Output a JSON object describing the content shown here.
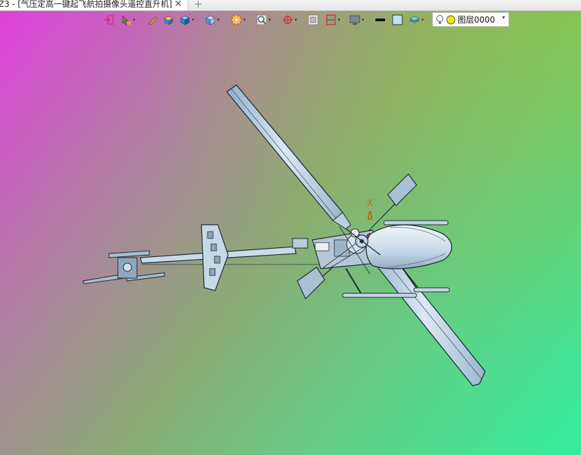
{
  "tab": {
    "title": "Z3 - [气压定高一键起飞航拍摄像头遥控直升机]",
    "close_glyph": "✕",
    "new_tab_glyph": "+"
  },
  "toolbar": {
    "items": [
      {
        "name": "exit-sketch-icon",
        "dropdown": false
      },
      {
        "name": "pick-filter-icon",
        "dropdown": true
      },
      {
        "name": "pencil-icon",
        "dropdown": false
      },
      {
        "name": "shaded-box-icon",
        "dropdown": false
      },
      {
        "name": "box-render-icon",
        "dropdown": true
      },
      {
        "name": "view-cube-icon",
        "dropdown": true
      },
      {
        "name": "color-wheel-icon",
        "dropdown": true
      },
      {
        "name": "zoom-fit-icon",
        "dropdown": true
      },
      {
        "name": "target-icon",
        "dropdown": true
      },
      {
        "name": "section-view-icon",
        "dropdown": false
      },
      {
        "name": "clipping-plane-icon",
        "dropdown": true
      },
      {
        "name": "display-monitor-icon",
        "dropdown": true
      },
      {
        "name": "line-color-icon",
        "dropdown": false
      },
      {
        "name": "fill-color-icon",
        "dropdown": false
      },
      {
        "name": "layers-icon",
        "dropdown": true
      }
    ],
    "layer_combo": {
      "label": "图层0000",
      "arrow": "▾"
    }
  },
  "viewport": {
    "axis_label": "X",
    "background_colors": [
      "#e23ee0",
      "#8bab75",
      "#35ee9c"
    ]
  }
}
